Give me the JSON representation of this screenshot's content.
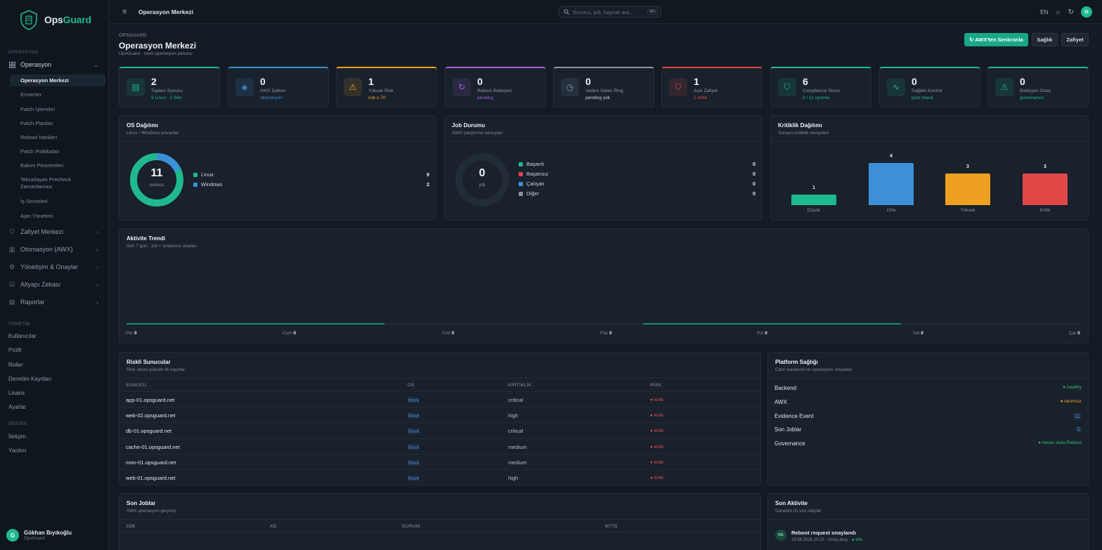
{
  "app": {
    "name_a": "Ops",
    "name_b": "Guard"
  },
  "sidebar": {
    "section_operasyon": "OPERASYON",
    "group_operasyon": "Operasyon",
    "items": [
      "Operasyon Merkezi",
      "Envanter",
      "Patch İşlemleri",
      "Patch Planları",
      "Reboot İstekleri",
      "Patch Politikaları",
      "Bakım Pencereleri",
      "Tekrarlayan Precheck Zamanlaması",
      "İş Servisleri",
      "Ajan Yönetimi"
    ],
    "groups": [
      "Zafiyet Merkezi",
      "Otomasyon (AWX)",
      "Yönetişim & Onaylar",
      "Altyapı Zekası",
      "Raporlar"
    ],
    "section_yonetim": "YÖNETİM",
    "yonetim": [
      "Kullanıcılar",
      "Profil",
      "Roller",
      "Denetim Kayıtları",
      "Lisans",
      "Ayarlar"
    ],
    "section_destek": "DESTEK",
    "destek": [
      "İletişim",
      "Yardım"
    ],
    "user": {
      "initial": "G",
      "name": "Gökhan Bıyıkoğlu",
      "org": "OpsGuard"
    }
  },
  "topbar": {
    "title": "Operasyon Merkezi",
    "search_placeholder": "Sunucu, job, kaynak ara...",
    "kbd": "⌘K",
    "lang": "EN",
    "avatar": "G"
  },
  "header": {
    "pre": "OPSGUARD",
    "title": "Operasyon Merkezi",
    "sub": "OpsGuard · canlı operasyon panosu",
    "btn_sync": "↻ AWX'ten Senkronla",
    "btn_health": "Sağlık",
    "btn_vuln": "Zafiyet"
  },
  "stats": [
    {
      "value": "2",
      "label": "Toplam Sunucu",
      "sub": "9 Linux · 2 Win",
      "color": "#20b98d",
      "sub_color": "#20b98d"
    },
    {
      "value": "0",
      "label": "AWX Şablon",
      "sub": "otomasyon",
      "color": "#3d8fd6",
      "sub_color": "#3d8fd6"
    },
    {
      "value": "1",
      "label": "Yüksek Risk",
      "sub": "risk ≥ 70",
      "color": "#f0a020",
      "sub_color": "#f0a020"
    },
    {
      "value": "0",
      "label": "Reboot Bekleyen",
      "sub": "pending",
      "color": "#a35fd0",
      "sub_color": "#a35fd0"
    },
    {
      "value": "0",
      "label": "Vadesi Gelen Ring",
      "sub": "pending yok",
      "color": "#8a96a5",
      "sub_color": "#c9d2dc"
    },
    {
      "value": "1",
      "label": "Açık Zafiyet",
      "sub": "2 kritik",
      "color": "#e04848",
      "sub_color": "#e04848"
    },
    {
      "value": "6",
      "label": "Compliance Skoru",
      "sub": "0 / 11 uyumlu",
      "color": "#20b98d",
      "sub_color": "#20b98d"
    },
    {
      "value": "0",
      "label": "Sağlıklı Kontrol",
      "sub": "post check",
      "color": "#20b98d",
      "sub_color": "#20b98d"
    },
    {
      "value": "0",
      "label": "Bekleyen Onay",
      "sub": "governance",
      "color": "#20b98d",
      "sub_color": "#20b98d"
    }
  ],
  "os_panel": {
    "title": "OS Dağılımı",
    "sub": "Linux / Windows envanter",
    "center_value": "11",
    "center_label": "sunucu",
    "legend": [
      {
        "name": "Linux",
        "value": "9",
        "color": "#20b98d"
      },
      {
        "name": "Windows",
        "value": "2",
        "color": "#3d8fd6"
      }
    ]
  },
  "job_panel": {
    "title": "Job Durumu",
    "sub": "AWX çalıştırma sonuçları",
    "center_value": "0",
    "center_label": "job",
    "legend": [
      {
        "name": "Başarılı",
        "value": "0",
        "color": "#20b98d"
      },
      {
        "name": "Başarısız",
        "value": "0",
        "color": "#e04848"
      },
      {
        "name": "Çalışan",
        "value": "0",
        "color": "#3d8fd6"
      },
      {
        "name": "Diğer",
        "value": "0",
        "color": "#8a96a5"
      }
    ]
  },
  "chart_data": {
    "type": "bar",
    "title": "Kritiklik Dağılımı",
    "subtitle": "Sunucu kritiklik seviyeleri",
    "categories": [
      "Düşük",
      "Orta",
      "Yüksek",
      "Kritik"
    ],
    "values": [
      1,
      4,
      3,
      3
    ],
    "colors": [
      "#20b98d",
      "#3d8fd6",
      "#f0a020",
      "#e04848"
    ],
    "ylim": [
      0,
      4
    ]
  },
  "trend": {
    "title": "Aktivite Trendi",
    "sub": "Son 7 gün · job + evidence olayları",
    "days": [
      {
        "d": "Per",
        "v": "0"
      },
      {
        "d": "Cum",
        "v": "0"
      },
      {
        "d": "Cmt",
        "v": "0"
      },
      {
        "d": "Paz",
        "v": "0"
      },
      {
        "d": "Pzt",
        "v": "0"
      },
      {
        "d": "Sal",
        "v": "0"
      },
      {
        "d": "Çar",
        "v": "0"
      }
    ]
  },
  "risky": {
    "title": "Riskli Sunucular",
    "sub": "Risk skoru yüksek ilk kayıtlar",
    "headers": [
      "SUNUCU",
      "OS",
      "KRİTİKLİK",
      "RİSK"
    ],
    "rows": [
      {
        "host": "app-01.opsguard.net",
        "os": "linux",
        "crit": "critical",
        "risk": "● kritik"
      },
      {
        "host": "web-02.opsguard.net",
        "os": "linux",
        "crit": "high",
        "risk": "● kritik"
      },
      {
        "host": "db-01.opsguard.net",
        "os": "linux",
        "crit": "critical",
        "risk": "● kritik"
      },
      {
        "host": "cache-01.opsguard.net",
        "os": "linux",
        "crit": "medium",
        "risk": "● kritik"
      },
      {
        "host": "mon-01.opsguard.net",
        "os": "linux",
        "crit": "medium",
        "risk": "● kritik"
      },
      {
        "host": "web-01.opsguard.net",
        "os": "linux",
        "crit": "high",
        "risk": "● kritik"
      }
    ]
  },
  "platform": {
    "title": "Platform Sağlığı",
    "sub": "Canlı backend ve operasyon sinyalleri",
    "rows": [
      {
        "name": "Backend",
        "value": "● healthy",
        "color": "#2fc46a"
      },
      {
        "name": "AWX",
        "value": "● tanımsız",
        "color": "#f0a020"
      },
      {
        "name": "Evidence Event",
        "value": "11",
        "color": "#4a90d9"
      },
      {
        "name": "Son Joblar",
        "value": "0",
        "color": "#4a90d9"
      },
      {
        "name": "Governance",
        "value": "● Never-Auto-Reboot",
        "color": "#2fc46a"
      }
    ]
  },
  "jobs": {
    "title": "Son Joblar",
    "sub": "AWX operasyon geçmişi",
    "headers": [
      "JOB",
      "AD",
      "DURUM",
      "BİTİŞ"
    ]
  },
  "activity": {
    "title": "Son Aktivite",
    "sub": "Denetim izi son olaylar",
    "item_badge": "RE",
    "item_title": "Reboot request onaylandı",
    "item_meta": "19.08.2026 10:25 · Onay akışı ·",
    "item_tag": "● info"
  }
}
